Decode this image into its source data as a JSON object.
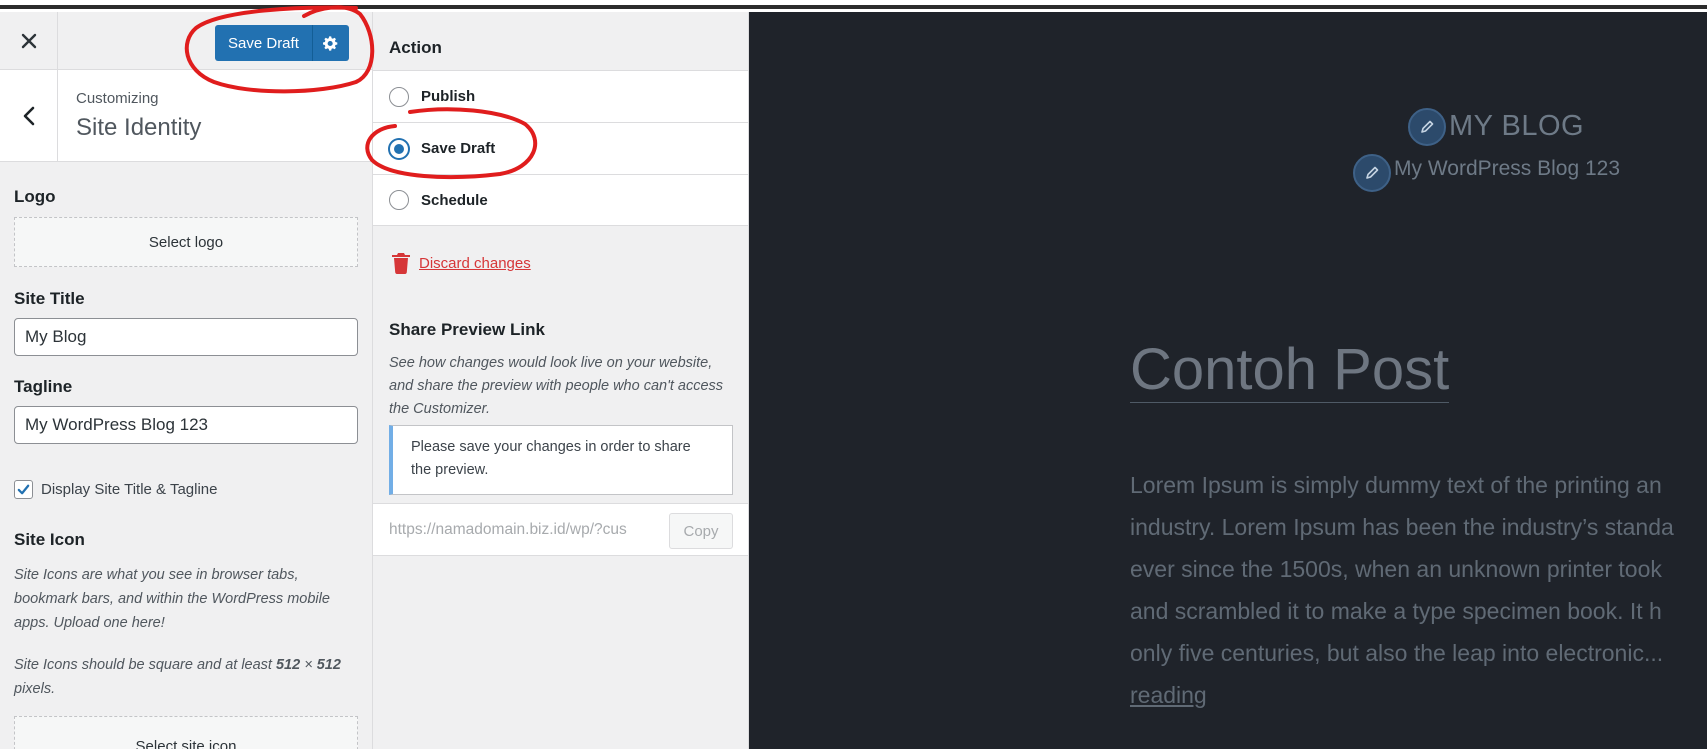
{
  "header": {
    "save_label": "Save Draft",
    "close_icon": "close-icon",
    "gear_icon": "gear-icon"
  },
  "section_header": {
    "small": "Customizing",
    "title": "Site Identity"
  },
  "logo": {
    "label": "Logo",
    "button": "Select logo"
  },
  "site_title": {
    "label": "Site Title",
    "value": "My Blog"
  },
  "tagline": {
    "label": "Tagline",
    "value": "My WordPress Blog 123"
  },
  "display_toggle": {
    "label": "Display Site Title & Tagline",
    "checked": true
  },
  "site_icon": {
    "label": "Site Icon",
    "desc1": "Site Icons are what you see in browser tabs, bookmark bars, and within the WordPress mobile apps. Upload one here!",
    "desc2_pre": "Site Icons should be square and at least ",
    "desc2_bold1": "512",
    "desc2_mid": " × ",
    "desc2_bold2": "512",
    "desc2_post": " pixels.",
    "button": "Select site icon"
  },
  "publish": {
    "action_label": "Action",
    "options": [
      {
        "label": "Publish",
        "selected": false
      },
      {
        "label": "Save Draft",
        "selected": true
      },
      {
        "label": "Schedule",
        "selected": false
      }
    ],
    "discard": "Discard changes",
    "share_title": "Share Preview Link",
    "share_desc": "See how changes would look live on your website, and share the preview with people who can't access the Customizer.",
    "notice": "Please save your changes in order to share the preview.",
    "link_value": "https://namadomain.biz.id/wp/?cus",
    "copy": "Copy"
  },
  "preview": {
    "site_title": "MY BLOG",
    "tagline": "My WordPress Blog 123",
    "post_title": "Contoh Post",
    "body_lines": [
      "Lorem Ipsum is simply dummy text of the printing an",
      "industry. Lorem Ipsum has been the industry’s standa",
      "ever since the 1500s, when an unknown printer took",
      "and scrambled it to make a type specimen book. It h",
      "only five centuries, but also the leap into electronic..."
    ],
    "read_more": "reading"
  },
  "colors": {
    "primary": "#2271b1",
    "danger": "#d63638",
    "preview_bg": "#1f232a",
    "annotation": "#e01d1d"
  }
}
